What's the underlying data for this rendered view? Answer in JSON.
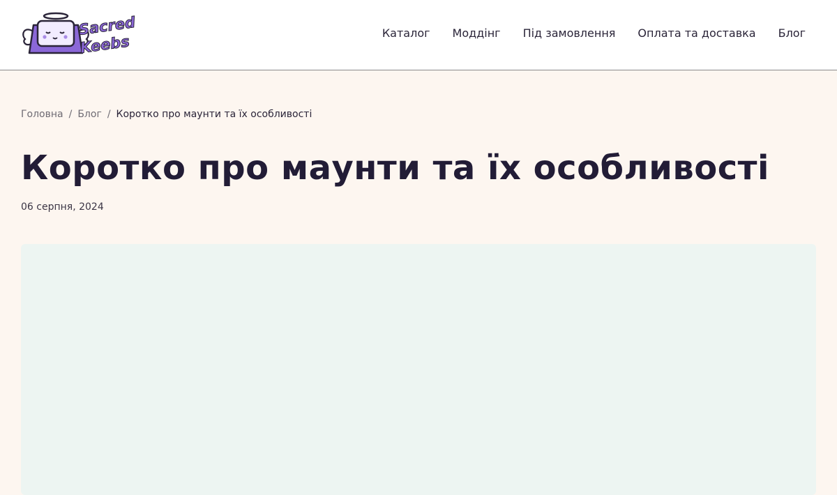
{
  "logo": {
    "line1": "Sacred",
    "line2": "Keebs"
  },
  "nav": [
    {
      "label": "Каталог"
    },
    {
      "label": "Моддінг"
    },
    {
      "label": "Під замовлення"
    },
    {
      "label": "Оплата та доставка"
    },
    {
      "label": "Блог"
    }
  ],
  "breadcrumb": {
    "home": "Головна",
    "blog": "Блог",
    "current": "Коротко про маунти та їх особливості",
    "separator": "/"
  },
  "article": {
    "title": "Коротко про маунти та їх особливості",
    "date": "06 серпня, 2024"
  },
  "colors": {
    "page_bg": "#fdf6f0",
    "header_bg": "#ffffff",
    "text_primary": "#221c36",
    "hero_bg": "#edf5f2",
    "brand_purple": "#8b67d8"
  }
}
